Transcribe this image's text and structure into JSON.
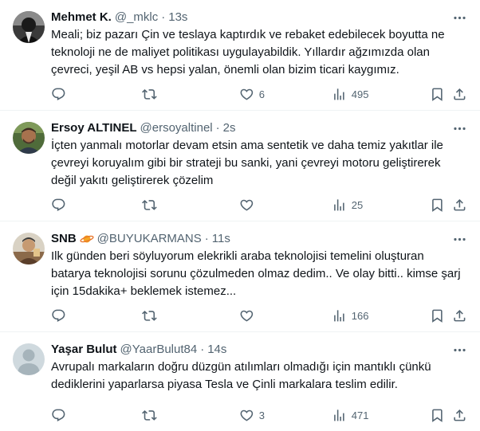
{
  "tweets": [
    {
      "name": "Mehmet K.",
      "handle": "@_mklc",
      "dot": "·",
      "time": "13s",
      "text": "Meali; biz pazarı Çin ve teslaya kaptırdık ve rebaket edebilecek boyutta ne teknoloji ne de maliyet politikası uygulayabildik. Yıllardır ağzımızda olan çevreci, yeşil AB vs hepsi yalan, önemli olan bizim ticari kaygımız.",
      "replies": "",
      "retweets": "",
      "likes": "6",
      "views": "495",
      "avatar": "dark-photo"
    },
    {
      "name": "Ersoy ALTINEL",
      "handle": "@ersoyaltinel",
      "dot": "·",
      "time": "2s",
      "text": "İçten yanmalı motorlar devam etsin ama sentetik ve daha temiz yakıtlar ile çevreyi koruyalım gibi bir strateji bu sanki, yani çevreyi motoru geliştirerek değil yakıtı geliştirerek çözelim",
      "replies": "",
      "retweets": "",
      "likes": "",
      "views": "25",
      "avatar": "green-photo"
    },
    {
      "name": "SNB",
      "badge_icon": "planet-emoji-icon",
      "handle": "@BUYUKARMANS",
      "dot": "·",
      "time": "11s",
      "text": "Ilk günden beri söyluyorum elekrikli araba teknolojisi temelini oluşturan batarya teknolojisi sorunu çözulmeden olmaz dedim.. Ve olay bitti.. kimse şarj için 15dakika+ beklemek istemez...",
      "replies": "",
      "retweets": "",
      "likes": "",
      "views": "166",
      "avatar": "warm-photo"
    },
    {
      "name": "Yaşar Bulut",
      "handle": "@YaarBulut84",
      "dot": "·",
      "time": "14s",
      "text": "Avrupalı markaların doğru düzgün atılımları olmadığı için mantıklı çünkü dediklerini yaparlarsa piyasa Tesla ve Çinli markalara teslim edilir.",
      "replies": "",
      "retweets": "",
      "likes": "3",
      "views": "471",
      "avatar": "default-avatar"
    }
  ],
  "colors": {
    "text": "#0f1419",
    "secondary": "#536471",
    "divider": "#eff3f4",
    "default_avatar_bg": "#cfd9de"
  }
}
